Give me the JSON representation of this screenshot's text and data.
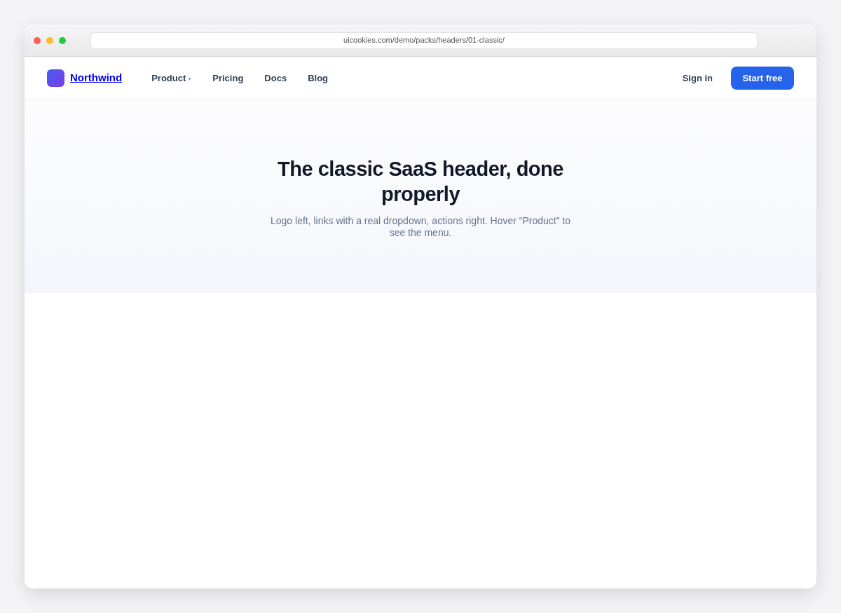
{
  "browser": {
    "url": "uicookies.com/demo/packs/headers/01-classic/"
  },
  "header": {
    "brand": "Northwind",
    "nav": [
      {
        "label": "Product",
        "kind": "dropdown"
      },
      {
        "label": "Pricing",
        "kind": "link"
      },
      {
        "label": "Docs",
        "kind": "link"
      },
      {
        "label": "Blog",
        "kind": "link"
      }
    ],
    "actions": [
      {
        "label": "Sign in",
        "kind": "link"
      },
      {
        "label": "Start free",
        "kind": "primary"
      }
    ]
  },
  "hero": {
    "title": "The classic SaaS header, done properly",
    "subtitle": "Logo left, links with a real dropdown, actions right. Hover “Product” to see the menu."
  }
}
